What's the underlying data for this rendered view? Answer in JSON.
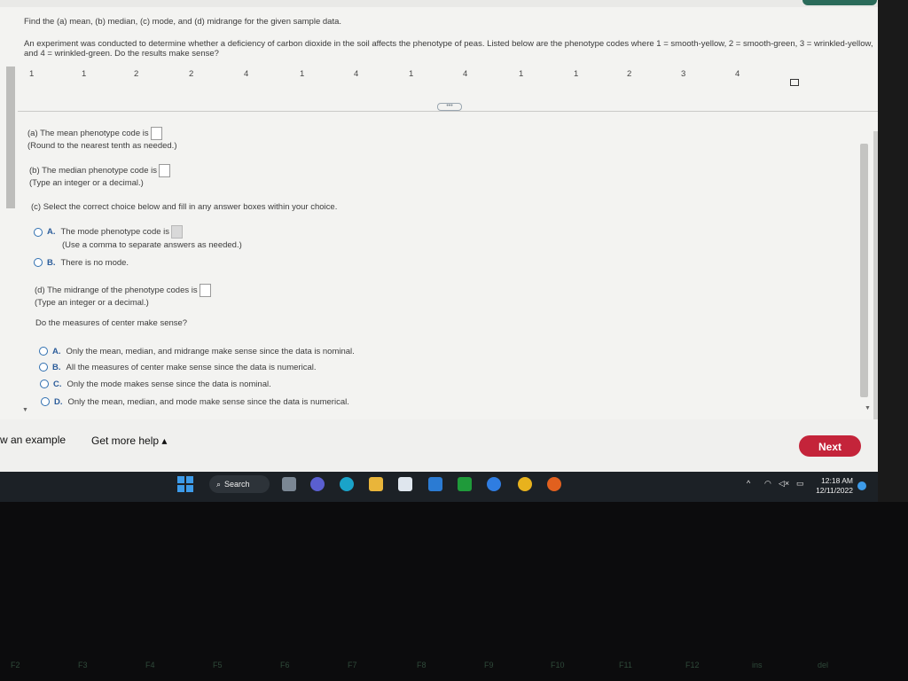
{
  "question": {
    "line1": "Find the (a) mean, (b) median, (c) mode, and (d) midrange for the given sample data.",
    "line2": "An experiment was conducted to determine whether a deficiency of carbon dioxide in the soil affects the phenotype of peas. Listed below are the phenotype codes where 1 = smooth-yellow, 2 = smooth-green, 3 = wrinkled-yellow, and 4 = wrinkled-green. Do the results make sense?",
    "data": [
      "1",
      "1",
      "2",
      "2",
      "4",
      "1",
      "4",
      "1",
      "4",
      "1",
      "1",
      "2",
      "3",
      "4"
    ]
  },
  "parts": {
    "a_label": "(a) The mean phenotype code is",
    "a_hint": "(Round to the nearest tenth as needed.)",
    "b_label": "(b) The median phenotype code is",
    "b_hint": "(Type an integer or a decimal.)",
    "c_label": "(c) Select the correct choice below and fill in any answer boxes within your choice.",
    "c_optA_letter": "A.",
    "c_optA_text": "The mode phenotype code is",
    "c_optA_hint": "(Use a comma to separate answers as needed.)",
    "c_optB_letter": "B.",
    "c_optB_text": "There is no mode.",
    "d_label": "(d) The midrange of the phenotype codes is",
    "d_hint": "(Type an integer or a decimal.)",
    "sense_q": "Do the measures of center make sense?",
    "sense_options": [
      {
        "letter": "A.",
        "text": "Only the mean, median, and midrange make sense since the data is nominal."
      },
      {
        "letter": "B.",
        "text": "All the measures of center make sense since the data is numerical."
      },
      {
        "letter": "C.",
        "text": "Only the mode makes sense since the data is nominal."
      },
      {
        "letter": "D.",
        "text": "Only the mean, median, and mode make sense since the data is numerical."
      }
    ]
  },
  "footer": {
    "example": "w an example",
    "help": "Get more help ▴",
    "next": "Next"
  },
  "taskbar": {
    "search": "Search",
    "time": "12:18 AM",
    "date": "12/11/2022"
  },
  "keys": [
    "F2",
    "F3",
    "F4",
    "F5",
    "F6",
    "F7",
    "F8",
    "F9",
    "F10",
    "F11",
    "F12",
    "ins",
    "del"
  ],
  "colors": {
    "next": "#c4243a",
    "radio": "#2f6fb0",
    "taskbar": "#1c2126"
  }
}
